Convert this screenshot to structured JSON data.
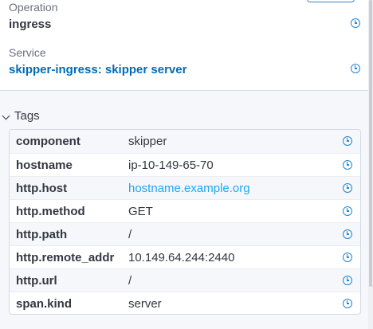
{
  "operation": {
    "label": "Operation",
    "value": "ingress"
  },
  "service": {
    "label": "Service",
    "value": "skipper-ingress: skipper server"
  },
  "tags": {
    "title": "Tags",
    "rows": [
      {
        "key": "component",
        "value": "skipper",
        "is_link": false
      },
      {
        "key": "hostname",
        "value": "ip-10-149-65-70",
        "is_link": false
      },
      {
        "key": "http.host",
        "value": "hostname.example.org",
        "is_link": true
      },
      {
        "key": "http.method",
        "value": "GET",
        "is_link": false
      },
      {
        "key": "http.path",
        "value": "/",
        "is_link": false
      },
      {
        "key": "http.remote_addr",
        "value": "10.149.64.244:2440",
        "is_link": false
      },
      {
        "key": "http.url",
        "value": "/",
        "is_link": false
      },
      {
        "key": "span.kind",
        "value": "server",
        "is_link": false
      }
    ]
  },
  "icons": {
    "filter_icon": "clock-icon",
    "collapse_icon": "chevron-down-icon"
  },
  "colors": {
    "accent": "#1f87d3",
    "link": "#1ba9f5",
    "service_link": "#006bb8"
  }
}
